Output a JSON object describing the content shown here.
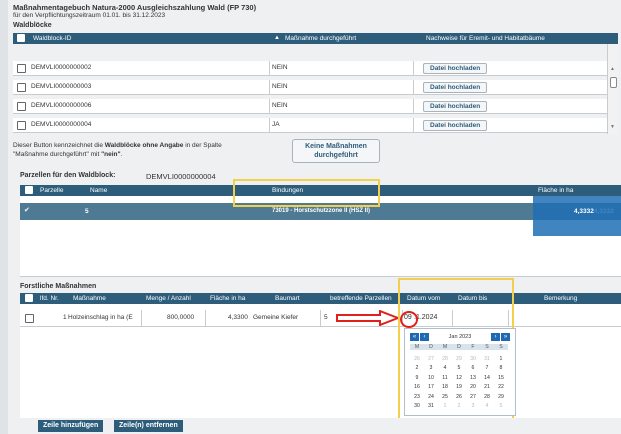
{
  "header": {
    "title": "Maßnahmentagebuch Natura-2000 Ausgleichszahlung Wald (FP 730)",
    "subtitle": "für den Verpflichtungszeitraum 01.01. bis 31.12.2023",
    "section_waldbloecke": "Waldblöcke"
  },
  "waldbloecke_table": {
    "columns": [
      "Waldblock-ID",
      "Maßnahme durchgeführt",
      "Nachweise für Eremit- und Habitatbäume"
    ],
    "sort_icon": "triangle-up-icon",
    "rows": [
      {
        "id": "DEMVLI0000000002",
        "massnahme": "NEIN",
        "button": "Datei hochladen"
      },
      {
        "id": "DEMVLI0000000003",
        "massnahme": "NEIN",
        "button": "Datei hochladen"
      },
      {
        "id": "DEMVLI0000000006",
        "massnahme": "NEIN",
        "button": "Datei hochladen"
      },
      {
        "id": "DEMVLI0000000004",
        "massnahme": "JA",
        "button": "Datei hochladen"
      }
    ]
  },
  "hint": {
    "text_prefix": "Dieser Button kennzeichnet die ",
    "text_bold": "Waldblöcke ohne Angabe",
    "text_suffix": " in der Spalte",
    "line2_prefix": "\"Maßnahme durchgeführt\" mit ",
    "line2_bold": "\"nein\"",
    "line2_suffix": ".",
    "button_line1": "Keine Maßnahmen",
    "button_line2": "durchgeführt"
  },
  "parzellen": {
    "label": "Parzellen für den Waldblock:",
    "waldblock_value": "DEMVLI0000000004",
    "columns": [
      "Parzelle",
      "Name",
      "Bindungen",
      "Fläche in ha"
    ],
    "rows": [
      {
        "parzelle": "5",
        "name": "",
        "bindungen": "73019 - Horstschutzzone II (HSZ II)",
        "flaeche": "4,3332"
      }
    ]
  },
  "forstliche": {
    "label": "Forstliche Maßnahmen",
    "columns": [
      "lfd. Nr.",
      "Maßnahme",
      "Menge / Anzahl",
      "Fläche in ha",
      "Baumart",
      "betreffende Parzellen",
      "Datum vom",
      "Datum bis",
      "Bemerkung"
    ],
    "rows": [
      {
        "nr": "1",
        "massnahme": "Holzeinschlag in ha (E",
        "menge": "800,0000",
        "flaeche": "4,3300",
        "baumart": "Gemeine Kiefer",
        "parzellen": "5",
        "datum_vom_day": "09",
        "datum_vom_rest": ".1.2024",
        "datum_bis": "",
        "bemerkung": ""
      }
    ]
  },
  "calendar": {
    "title": "Jan 2023",
    "prev_icons": [
      "double-chevron-left-icon",
      "chevron-left-icon"
    ],
    "next_icons": [
      "chevron-right-icon",
      "double-chevron-right-icon"
    ],
    "weekdays": [
      "M",
      "D",
      "M",
      "D",
      "F",
      "S",
      "S"
    ],
    "weeks": [
      [
        "26",
        "27",
        "28",
        "29",
        "30",
        "31",
        "1"
      ],
      [
        "2",
        "3",
        "4",
        "5",
        "6",
        "7",
        "8"
      ],
      [
        "9",
        "10",
        "11",
        "12",
        "13",
        "14",
        "15"
      ],
      [
        "16",
        "17",
        "18",
        "19",
        "20",
        "21",
        "22"
      ],
      [
        "23",
        "24",
        "25",
        "26",
        "27",
        "28",
        "29"
      ],
      [
        "30",
        "31",
        "1",
        "2",
        "3",
        "4",
        "5"
      ]
    ]
  },
  "footer": {
    "add_row": "Zeile hinzufügen",
    "remove_rows": "Zeile(n) entfernen"
  },
  "colors": {
    "header_blue": "#2e5d7c",
    "selected_row": "#4f7a94",
    "highlight_yellow": "#f2d04e",
    "annotation_red": "#e0201b",
    "calendar_nav_blue": "#1f68b3"
  }
}
